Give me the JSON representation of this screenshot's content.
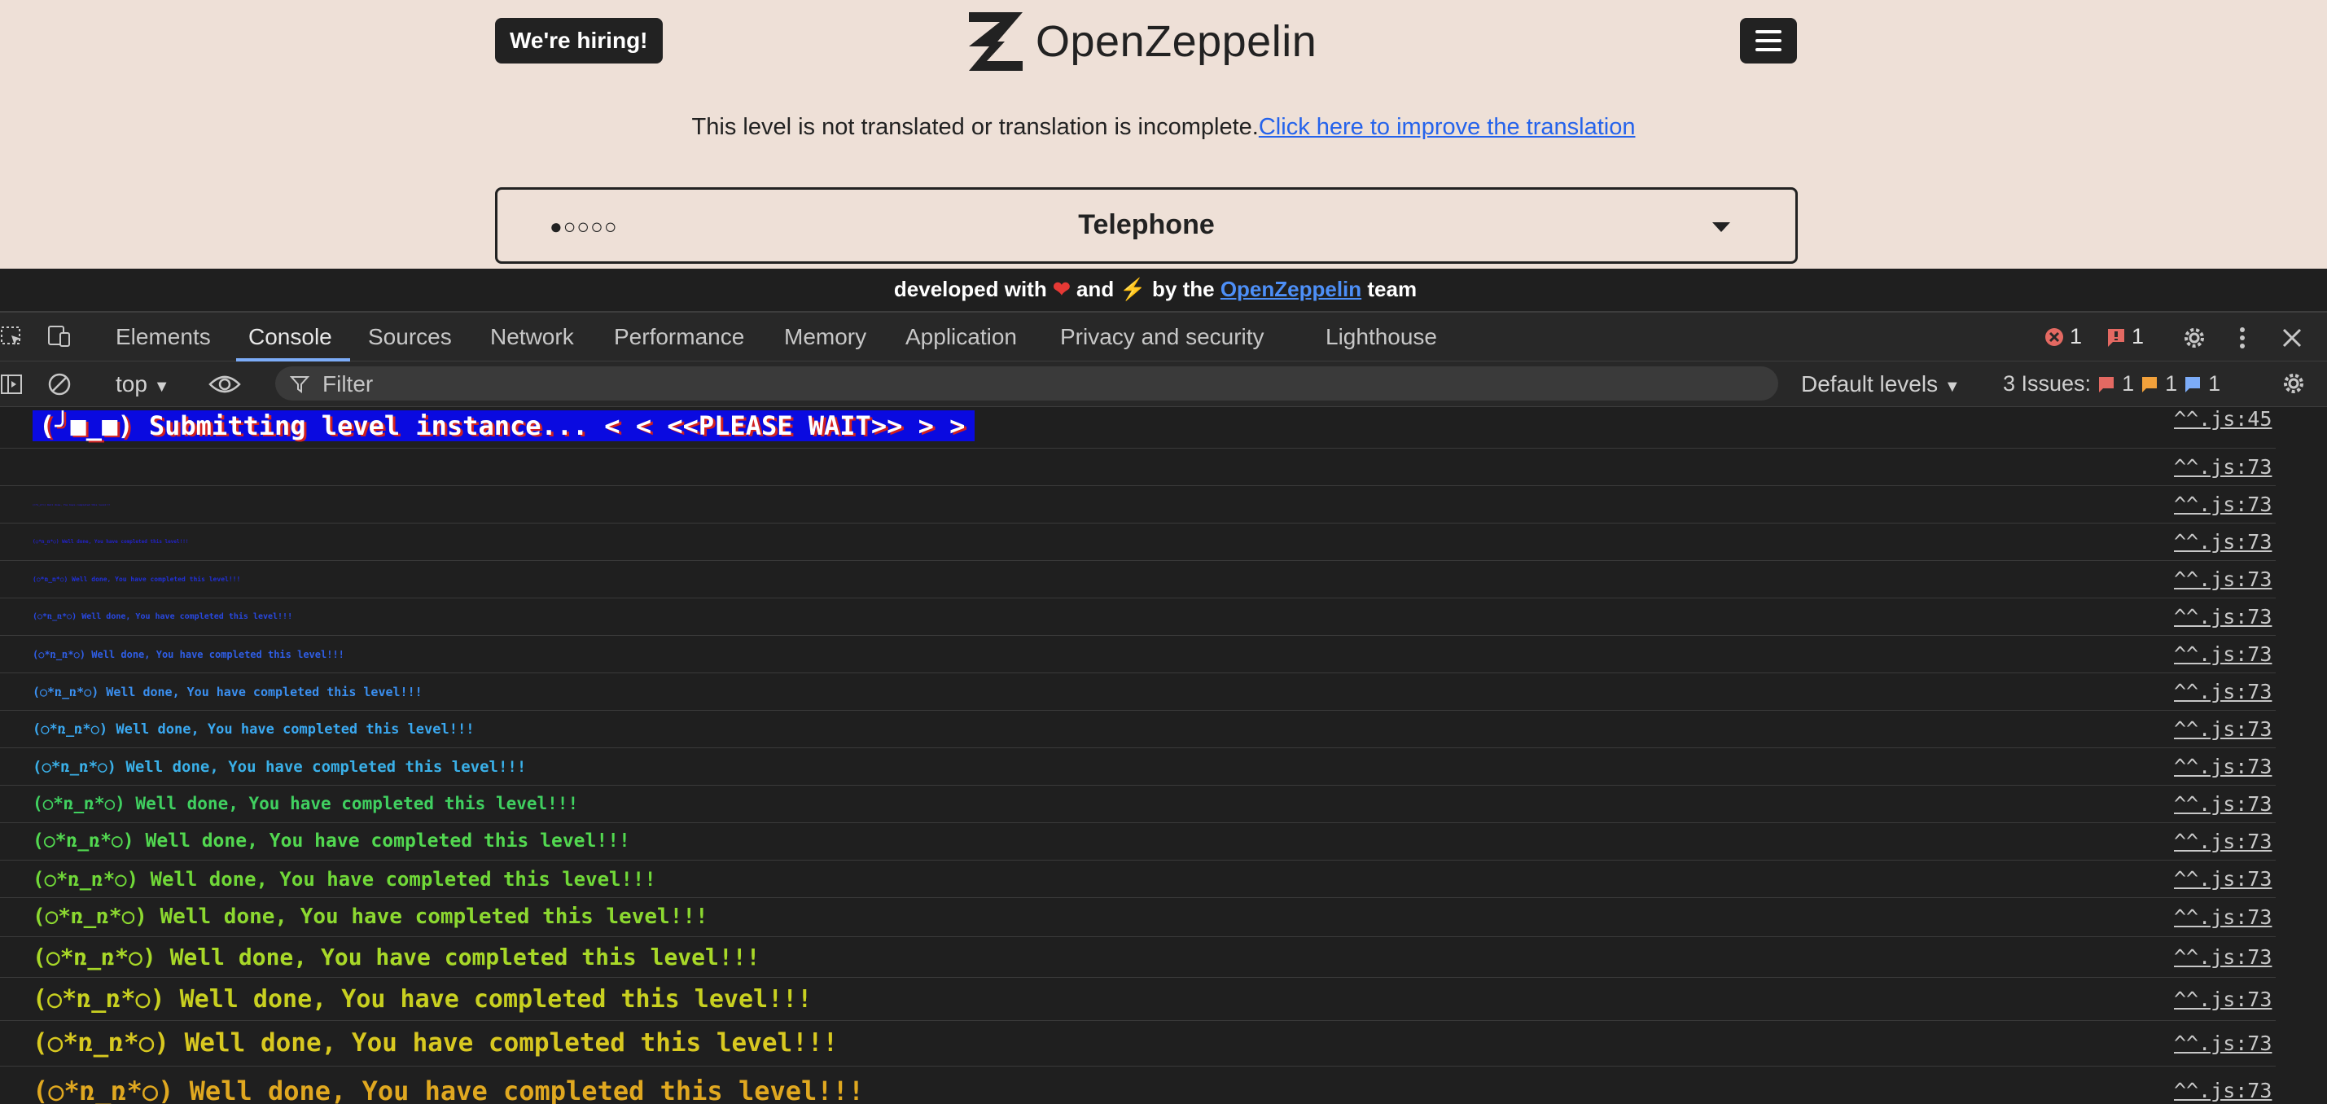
{
  "site": {
    "hiring_label": "We're hiring!",
    "brand_name": "OpenZeppelin",
    "notice_text": "This level is not translated or translation is incomplete.",
    "notice_link": "Click here to improve the translation",
    "level_dots": "●○○○○",
    "level_title": "Telephone",
    "footer": {
      "pre": "developed with ",
      "heart": "❤",
      "mid": " and ",
      "bolt": "⚡",
      "by": " by the ",
      "link": "OpenZeppelin",
      "post": " team"
    }
  },
  "devtools": {
    "tabs": [
      "Elements",
      "Console",
      "Sources",
      "Network",
      "Performance",
      "Memory",
      "Application",
      "Privacy and security",
      "Lighthouse"
    ],
    "error_count": "1",
    "issue_flag_count": "1",
    "context": "top",
    "filter_placeholder": "Filter",
    "levels_label": "Default levels",
    "issues_label": "3 Issues:",
    "issues_counts": [
      "1",
      "1",
      "1"
    ]
  },
  "console": {
    "banner": {
      "left": "(╯■_■) Submitting level instance...",
      "right": "<  < <<PLEASE WAIT>> >  >",
      "source": "^^.js:45"
    },
    "repeat_source": "^^.js:73",
    "repeat_message": "(○*ռ_ռ*○) Well done, You have completed this level!!!",
    "rows": [
      {
        "size": 0,
        "color": "#1a1a9a"
      },
      {
        "size": 3,
        "color": "#2a20b8"
      },
      {
        "size": 6,
        "color": "#2222cc"
      },
      {
        "size": 8,
        "color": "#2030d8"
      },
      {
        "size": 10,
        "color": "#2848e0"
      },
      {
        "size": 12,
        "color": "#2f5ee6"
      },
      {
        "size": 15,
        "color": "#3a8ff0"
      },
      {
        "size": 17,
        "color": "#3aa8f0"
      },
      {
        "size": 19,
        "color": "#3ab0e8"
      },
      {
        "size": 21,
        "color": "#40d060"
      },
      {
        "size": 23,
        "color": "#52d850"
      },
      {
        "size": 24,
        "color": "#70d838"
      },
      {
        "size": 26,
        "color": "#8cd830"
      },
      {
        "size": 28,
        "color": "#a8d828"
      },
      {
        "size": 30,
        "color": "#c8d020"
      },
      {
        "size": 31,
        "color": "#d8c820"
      },
      {
        "size": 32,
        "color": "#e0a820"
      }
    ]
  }
}
